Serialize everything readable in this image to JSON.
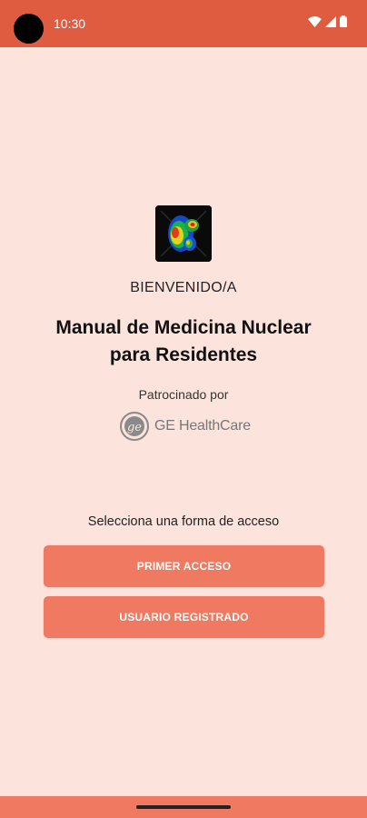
{
  "status_bar": {
    "time": "10:30",
    "icons": [
      "wifi-icon",
      "signal-icon",
      "battery-icon"
    ]
  },
  "app_logo": {
    "icon": "nuclear-scan-icon"
  },
  "welcome": "BIENVENIDO/A",
  "title_line1": "Manual de Medicina Nuclear",
  "title_line2": "para Residentes",
  "sponsored_by": "Patrocinado por",
  "sponsor": {
    "name": "GE HealthCare",
    "icon": "ge-monogram-icon"
  },
  "access_prompt": "Selecciona una forma de acceso",
  "buttons": {
    "first_access": "PRIMER ACCESO",
    "registered_user": "USUARIO REGISTRADO"
  },
  "colors": {
    "status_bar": "#df5c40",
    "background": "#fce4dc",
    "button": "#ef7a61"
  }
}
